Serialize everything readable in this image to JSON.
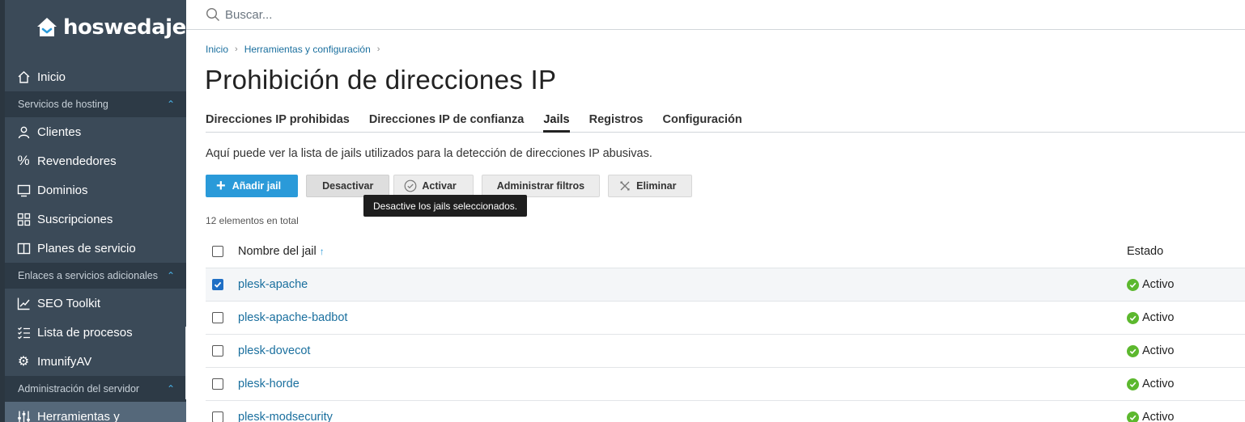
{
  "brand": {
    "name": "hoswedaje"
  },
  "search": {
    "placeholder": "Buscar..."
  },
  "sidebar": {
    "items": [
      {
        "label": "Inicio"
      },
      {
        "section": "Servicios de hosting"
      },
      {
        "label": "Clientes"
      },
      {
        "label": "Revendedores"
      },
      {
        "label": "Dominios"
      },
      {
        "label": "Suscripciones"
      },
      {
        "label": "Planes de servicio"
      },
      {
        "section": "Enlaces a servicios adicionales"
      },
      {
        "label": "SEO Toolkit"
      },
      {
        "label": "Lista de procesos"
      },
      {
        "label": "ImunifyAV"
      },
      {
        "section": "Administración del servidor"
      },
      {
        "label": "Herramientas y"
      }
    ]
  },
  "breadcrumb": [
    "Inicio",
    "Herramientas y configuración"
  ],
  "page": {
    "title": "Prohibición de direcciones IP",
    "intro": "Aquí puede ver la lista de jails utilizados para la detección de direcciones IP abusivas.",
    "count": "12 elementos en total"
  },
  "tabs": [
    "Direcciones IP prohibidas",
    "Direcciones IP de confianza",
    "Jails",
    "Registros",
    "Configuración"
  ],
  "active_tab": "Jails",
  "toolbar": {
    "add": "Añadir jail",
    "deactivate": "Desactivar",
    "activate": "Activar",
    "filters": "Administrar filtros",
    "delete": "Eliminar"
  },
  "tooltip": "Desactive los jails seleccionados.",
  "table": {
    "headers": {
      "name": "Nombre del jail",
      "sort": "↑",
      "status": "Estado"
    },
    "rows": [
      {
        "name": "plesk-apache",
        "status": "Activo",
        "checked": true
      },
      {
        "name": "plesk-apache-badbot",
        "status": "Activo",
        "checked": false
      },
      {
        "name": "plesk-dovecot",
        "status": "Activo",
        "checked": false
      },
      {
        "name": "plesk-horde",
        "status": "Activo",
        "checked": false
      },
      {
        "name": "plesk-modsecurity",
        "status": "Activo",
        "checked": false
      }
    ]
  },
  "colors": {
    "sidebar": "#3b4a58",
    "accent": "#2a9ad9",
    "link": "#1a6f9e",
    "status_ok": "#5cb82e"
  }
}
